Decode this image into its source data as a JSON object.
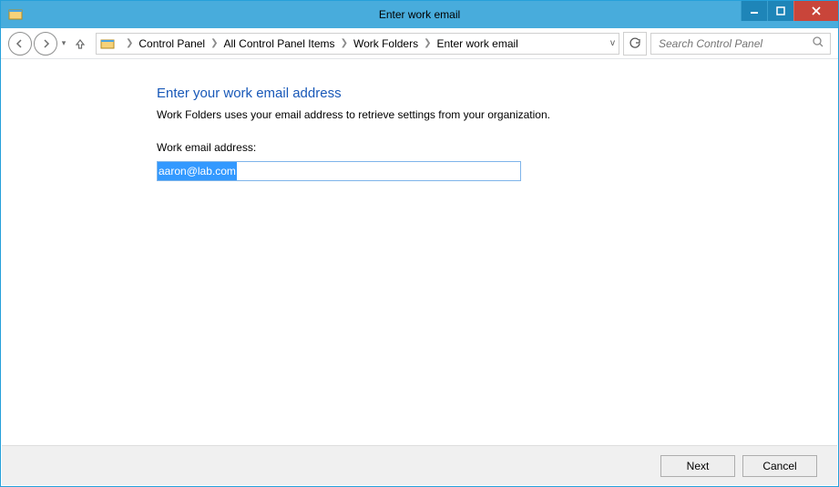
{
  "window": {
    "title": "Enter work email"
  },
  "breadcrumb": {
    "items": [
      "Control Panel",
      "All Control Panel Items",
      "Work Folders",
      "Enter work email"
    ]
  },
  "search": {
    "placeholder": "Search Control Panel"
  },
  "page": {
    "heading": "Enter your work email address",
    "description": "Work Folders uses your email address to retrieve settings from your organization.",
    "field_label": "Work email address:",
    "email_value": "aaron@lab.com"
  },
  "buttons": {
    "next": "Next",
    "cancel": "Cancel"
  }
}
